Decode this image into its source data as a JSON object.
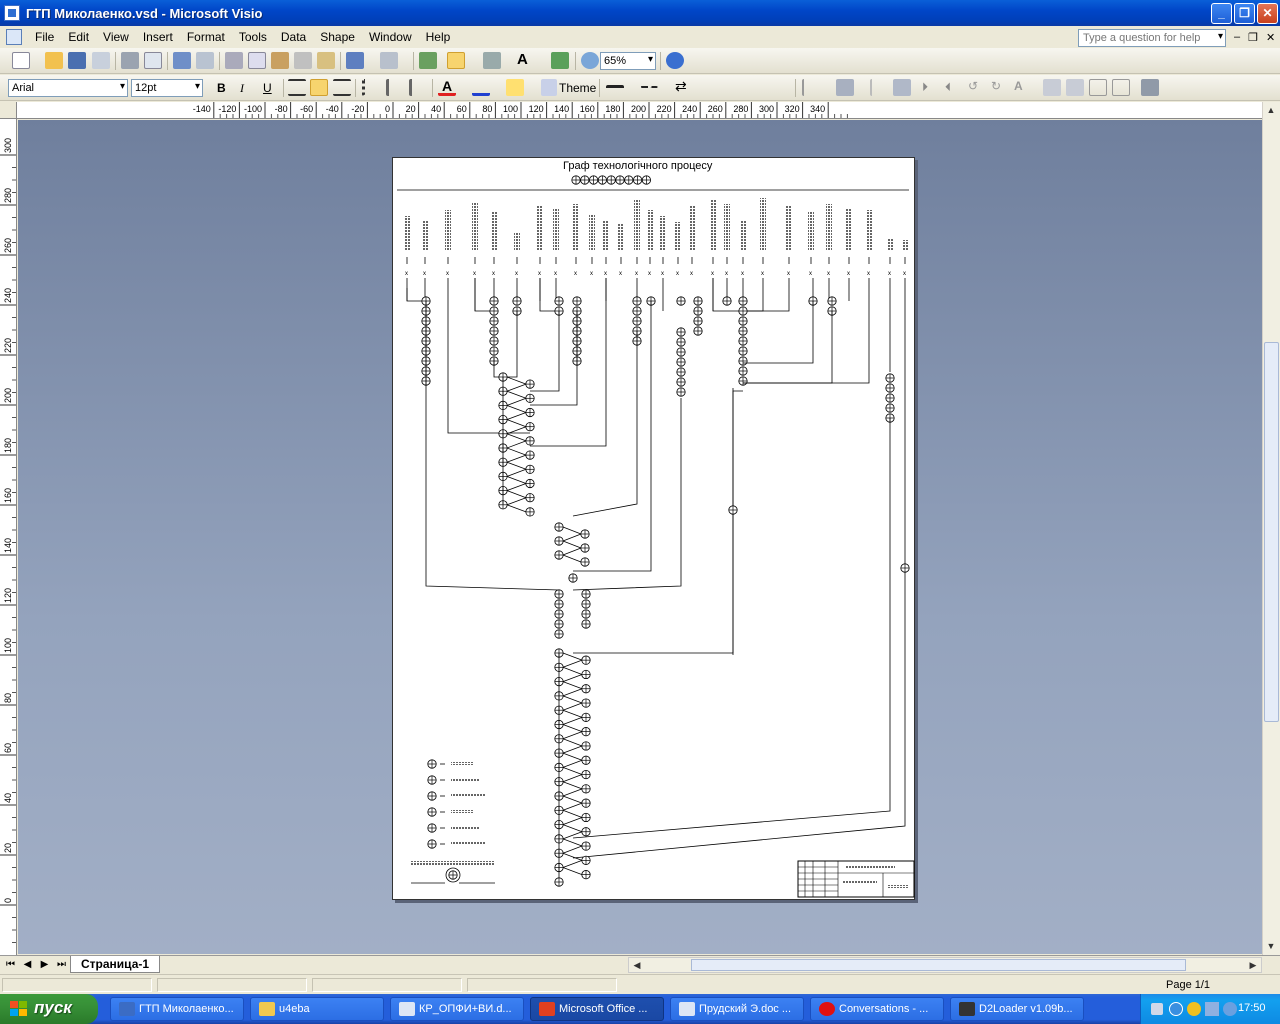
{
  "window": {
    "title": "ГТП Миколаенко.vsd - Microsoft Visio",
    "minimize_glyph": "_",
    "maximize_glyph": "❐",
    "close_glyph": "✕"
  },
  "menu": {
    "items": [
      "File",
      "Edit",
      "View",
      "Insert",
      "Format",
      "Tools",
      "Data",
      "Shape",
      "Window",
      "Help"
    ],
    "help_placeholder": "Type a question for help"
  },
  "toolbar_standard": {
    "zoom": "65%"
  },
  "toolbar_format": {
    "font": "Arial",
    "size": "12pt",
    "bold": "B",
    "italic": "I",
    "underline": "U",
    "theme_label": "Theme"
  },
  "ruler": {
    "h_ticks": [
      "-140",
      "-120",
      "-100",
      "-80",
      "-60",
      "-40",
      "-20",
      "0",
      "20",
      "40",
      "60",
      "80",
      "100",
      "120",
      "140",
      "160",
      "180",
      "200",
      "220",
      "240",
      "260",
      "280",
      "300",
      "320",
      "340"
    ],
    "v_ticks": [
      "300",
      "280",
      "260",
      "240",
      "220",
      "200",
      "180",
      "160",
      "140",
      "120",
      "100",
      "80",
      "60",
      "40",
      "20",
      "0"
    ]
  },
  "drawing": {
    "title": "Граф технологічного процесу"
  },
  "tabs": {
    "page_tab": "Страница-1"
  },
  "status": {
    "page": "Page 1/1"
  },
  "taskbar": {
    "start_label": "пуск",
    "tasks": [
      {
        "label": "ГТП Миколаенко...",
        "active": false
      },
      {
        "label": "u4eba",
        "active": false
      },
      {
        "label": "КР_ОПФИ+ВИ.d...",
        "active": false
      },
      {
        "label": "Microsoft Office ...",
        "active": true
      },
      {
        "label": "Прудский Э.doc ...",
        "active": false
      },
      {
        "label": "Conversations - ...",
        "active": false
      },
      {
        "label": "D2Loader v1.09b...",
        "active": false
      }
    ],
    "clock": "17:50"
  },
  "colors": {
    "title_bar": "#0a5fd8",
    "canvas": "#8392ad",
    "taskbar": "#245edb",
    "start": "#379037"
  }
}
